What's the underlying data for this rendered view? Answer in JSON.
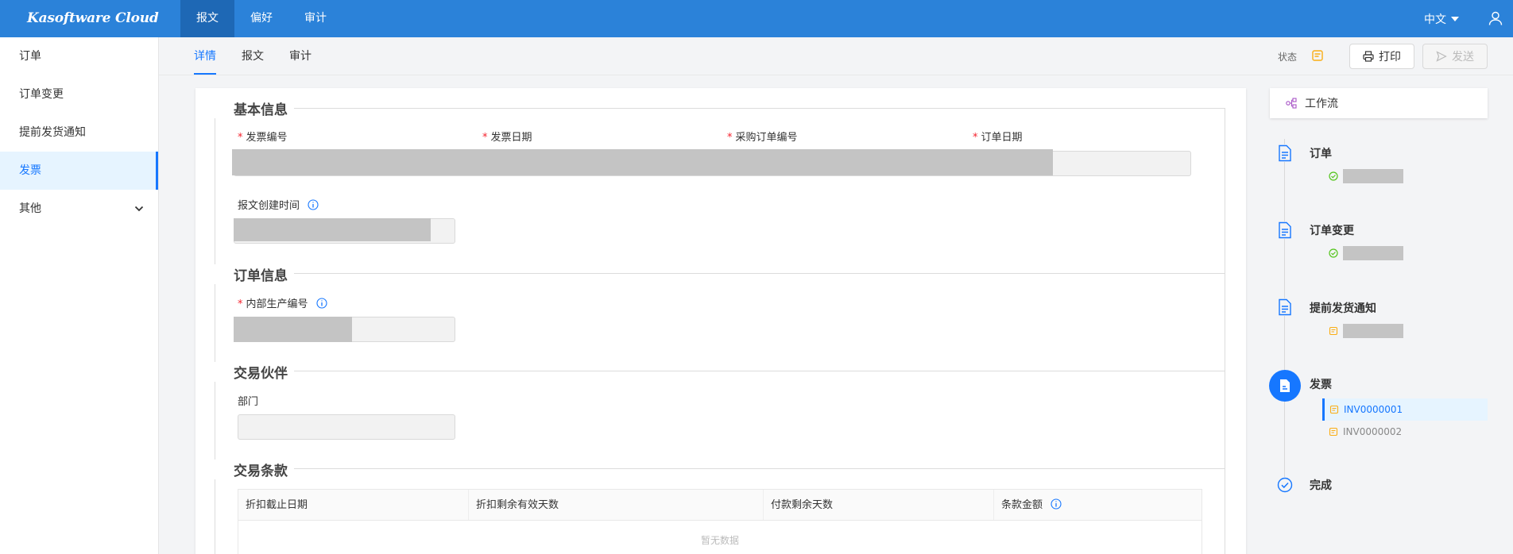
{
  "app": {
    "brand": "Kasoftware Cloud"
  },
  "topnav": {
    "items": [
      "报文",
      "偏好",
      "审计"
    ],
    "active_index": 0
  },
  "language": "中文",
  "sidebar": {
    "items": [
      {
        "label": "订单"
      },
      {
        "label": "订单变更"
      },
      {
        "label": "提前发货通知"
      },
      {
        "label": "发票",
        "active": true
      },
      {
        "label": "其他",
        "has_submenu": true
      }
    ]
  },
  "tabs": {
    "items": [
      "详情",
      "报文",
      "审计"
    ],
    "active_index": 0
  },
  "toolbar": {
    "status_label": "状态",
    "print_label": "打印",
    "send_label": "发送"
  },
  "sections": {
    "basic": {
      "title": "基本信息",
      "invoice_no_label": "发票编号",
      "invoice_date_label": "发票日期",
      "po_no_label": "采购订单编号",
      "order_date_label": "订单日期",
      "created_time_label": "报文创建时间"
    },
    "order": {
      "title": "订单信息",
      "internal_no_label": "内部生产编号"
    },
    "partner": {
      "title": "交易伙伴",
      "department_label": "部门"
    },
    "terms": {
      "title": "交易条款",
      "columns": [
        "折扣截止日期",
        "折扣剩余有效天数",
        "付款剩余天数",
        "条款金额"
      ],
      "empty_text": "暂无数据"
    }
  },
  "workflow": {
    "header": "工作流",
    "steps": [
      {
        "label": "订单"
      },
      {
        "label": "订单变更"
      },
      {
        "label": "提前发货通知"
      },
      {
        "label": "发票",
        "documents": [
          "INV0000001",
          "INV0000002"
        ]
      },
      {
        "label": "完成"
      }
    ]
  },
  "colors": {
    "primary": "#2b82d9",
    "accent": "#1677ff",
    "success": "#52c41a",
    "pending": "#faad14",
    "required": "#f5222d"
  }
}
